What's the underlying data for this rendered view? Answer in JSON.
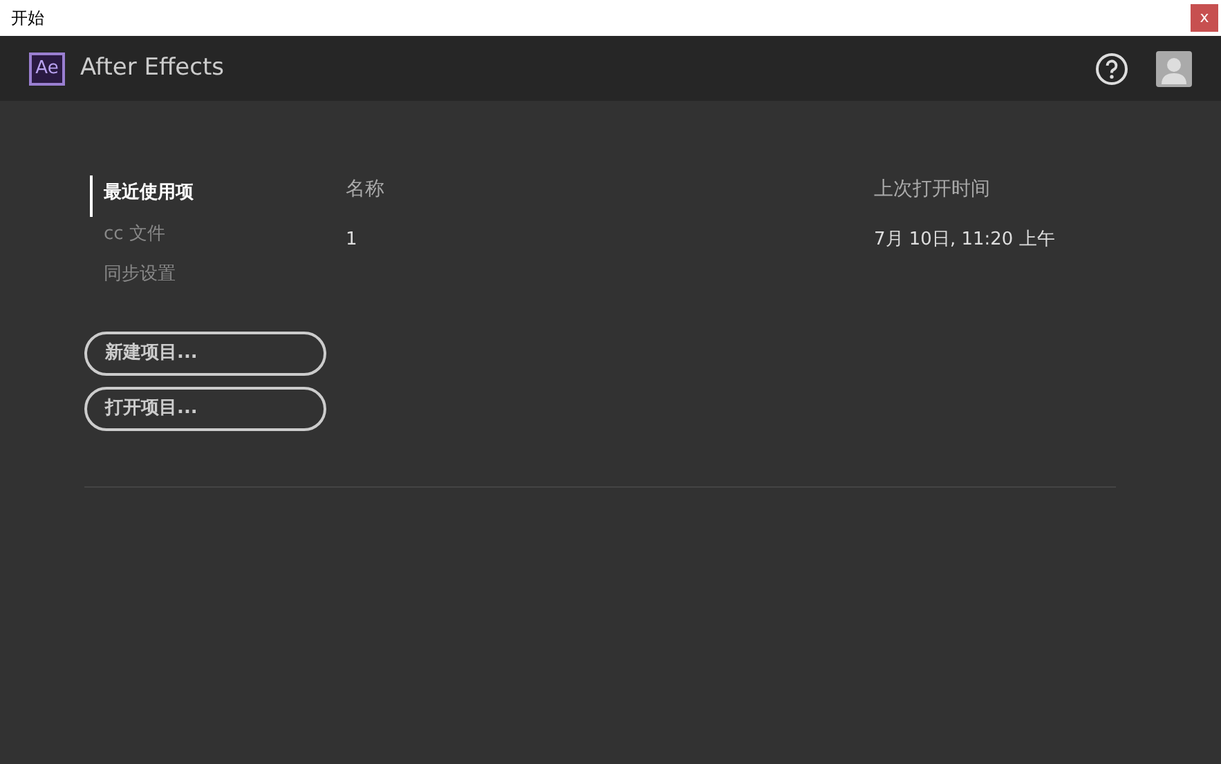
{
  "window": {
    "title": "开始",
    "close": "x"
  },
  "header": {
    "logo": "Ae",
    "app_name": "After Effects"
  },
  "sidebar": {
    "items": [
      {
        "label": "最近使用项",
        "selected": true
      },
      {
        "label": "cc 文件",
        "selected": false
      },
      {
        "label": "同步设置",
        "selected": false
      }
    ]
  },
  "buttons": [
    "新建项目...",
    "打开项目..."
  ],
  "table": {
    "columns": [
      "名称",
      "上次打开时间"
    ],
    "rows": [
      [
        "1",
        "7月 10日, 11:20 上午"
      ]
    ]
  }
}
